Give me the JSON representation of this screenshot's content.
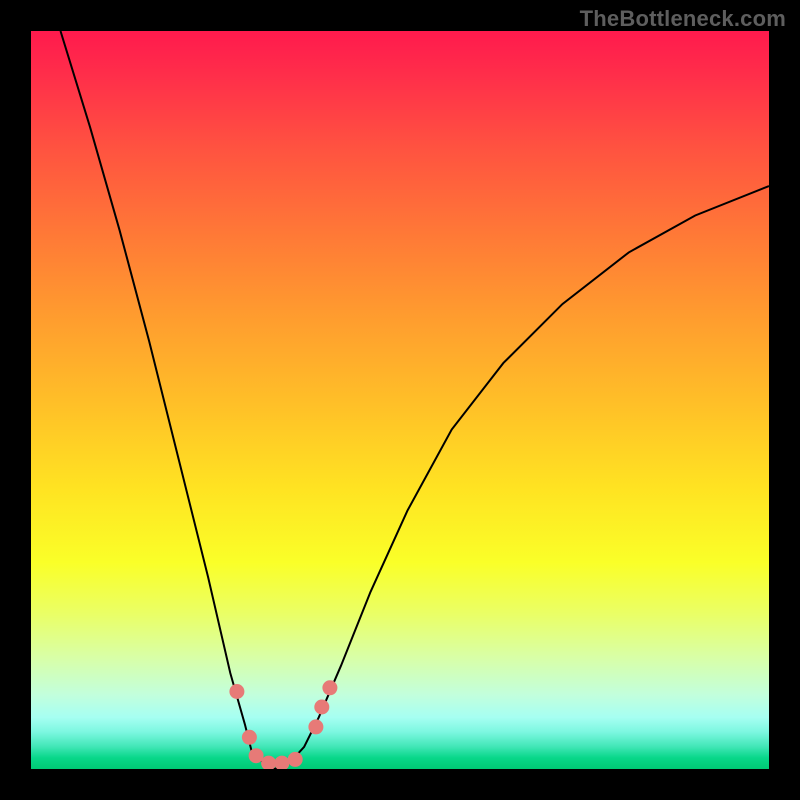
{
  "watermark": "TheBottleneck.com",
  "colors": {
    "background": "#000000",
    "curve": "#000000",
    "marker": "#e77a77"
  },
  "chart_data": {
    "type": "line",
    "title": "",
    "xlabel": "",
    "ylabel": "",
    "xlim": [
      0,
      100
    ],
    "ylim": [
      0,
      100
    ],
    "note": "Axes are unlabeled in the image; x and y are normalized 0–100 left→right and bottom→top. Values are estimated from the curve pixels. Low y = good (valley near x≈33).",
    "grid": false,
    "legend": false,
    "series": [
      {
        "name": "bottleneck-curve",
        "x": [
          4,
          8,
          12,
          16,
          20,
          24,
          27,
          29,
          30,
          32,
          33,
          35,
          37,
          39,
          42,
          46,
          51,
          57,
          64,
          72,
          81,
          90,
          100
        ],
        "y": [
          100,
          87,
          73,
          58,
          42,
          26,
          13,
          6,
          2,
          0.5,
          0,
          0.8,
          3,
          7,
          14,
          24,
          35,
          46,
          55,
          63,
          70,
          75,
          79
        ]
      }
    ],
    "markers": {
      "name": "highlighted-points",
      "note": "Salmon dots near the valley; same normalized coordinate system.",
      "points": [
        {
          "x": 27.9,
          "y": 10.5
        },
        {
          "x": 29.6,
          "y": 4.3
        },
        {
          "x": 30.5,
          "y": 1.8
        },
        {
          "x": 32.2,
          "y": 0.8
        },
        {
          "x": 34.0,
          "y": 0.8
        },
        {
          "x": 35.8,
          "y": 1.3
        },
        {
          "x": 38.6,
          "y": 5.7
        },
        {
          "x": 39.4,
          "y": 8.4
        },
        {
          "x": 40.5,
          "y": 11.0
        }
      ]
    },
    "background_gradient": {
      "direction": "vertical",
      "stops": [
        {
          "pos": 0.0,
          "color": "#ff1a4d"
        },
        {
          "pos": 0.5,
          "color": "#ffbe28"
        },
        {
          "pos": 0.72,
          "color": "#faff28"
        },
        {
          "pos": 0.9,
          "color": "#c2ffdd"
        },
        {
          "pos": 1.0,
          "color": "#00c974"
        }
      ]
    }
  }
}
